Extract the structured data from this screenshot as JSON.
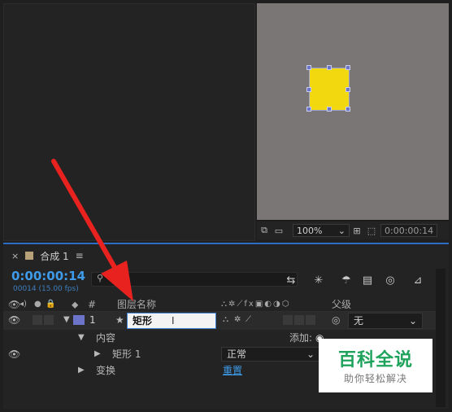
{
  "viewer": {
    "zoom": "100%",
    "timecode": "0:00:00:14",
    "colors": {
      "canvas": "#7a7676",
      "shape": "#f2d90f"
    }
  },
  "timeline": {
    "tab_label": "合成 1",
    "timecode": "0:00:00:14",
    "fps": "00014 (15.00 fps)",
    "accent_color": "#3e9bea",
    "headers": {
      "number": "#",
      "layer_name": "图层名称",
      "parent": "父级"
    },
    "layer": {
      "index": "1",
      "name": "矩形",
      "parent": "无",
      "label_color": "#6b74c8"
    },
    "contents_label": "内容",
    "add_label": "添加:",
    "shape_group": "矩形 1",
    "blend_mode": "正常",
    "transform_label": "变换",
    "reset_label": "重置"
  },
  "watermark": {
    "title": "百科全说",
    "subtitle": "助你轻松解决"
  }
}
